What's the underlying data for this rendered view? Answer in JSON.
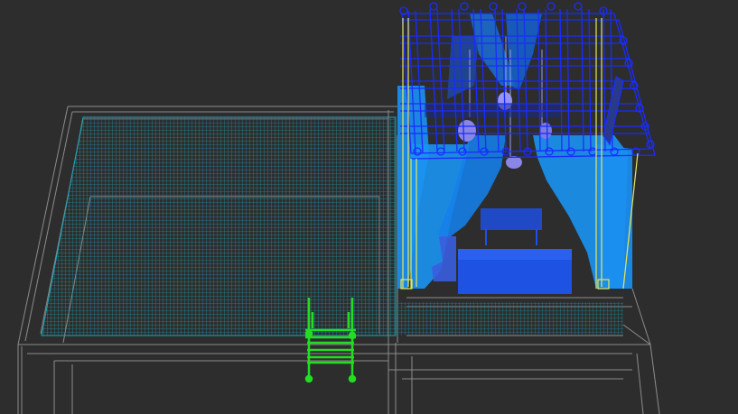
{
  "viewport": {
    "view": "perspective",
    "shading": "wireframe",
    "background": "#2d2d2d"
  },
  "colors": {
    "ground_wire": "#8a8a8a",
    "pool_mesh": "#1e8fa0",
    "curtain": "#1a8ff0",
    "roof_wire": "#1a2cff",
    "furniture": "#1e4fe0",
    "lamp": "#8a86e8",
    "ladder_selected": "#22dd22",
    "post_highlight": "#e6e85a"
  },
  "objects": [
    {
      "name": "ground-platform",
      "type": "box"
    },
    {
      "name": "pool-water",
      "type": "mesh"
    },
    {
      "name": "pergola-roof",
      "type": "beams"
    },
    {
      "name": "pergola-curtains",
      "type": "mesh"
    },
    {
      "name": "lounge-sofa",
      "type": "mesh"
    },
    {
      "name": "side-table",
      "type": "mesh"
    },
    {
      "name": "pendant-lamps",
      "type": "mesh"
    },
    {
      "name": "pool-ladder",
      "type": "mesh",
      "selected": true
    }
  ]
}
